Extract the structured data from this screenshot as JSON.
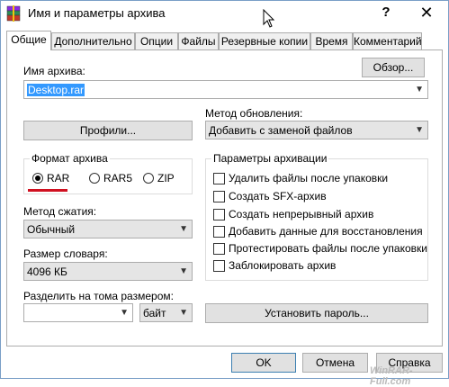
{
  "window": {
    "title": "Имя и параметры архива",
    "help_label": "?",
    "close_label": "✕"
  },
  "tabs": [
    {
      "label": "Общие"
    },
    {
      "label": "Дополнительно"
    },
    {
      "label": "Опции"
    },
    {
      "label": "Файлы"
    },
    {
      "label": "Резервные копии"
    },
    {
      "label": "Время"
    },
    {
      "label": "Комментарий"
    }
  ],
  "archive_name": {
    "label": "Имя архива:",
    "value": "Desktop.rar",
    "browse_label": "Обзор..."
  },
  "profiles_label": "Профили...",
  "update_method": {
    "label": "Метод обновления:",
    "value": "Добавить с заменой файлов"
  },
  "format": {
    "title": "Формат архива",
    "options": [
      {
        "label": "RAR",
        "selected": true
      },
      {
        "label": "RAR5",
        "selected": false
      },
      {
        "label": "ZIP",
        "selected": false
      }
    ]
  },
  "compression": {
    "label": "Метод сжатия:",
    "value": "Обычный"
  },
  "dictionary": {
    "label": "Размер словаря:",
    "value": "4096 КБ"
  },
  "split": {
    "label": "Разделить на тома размером:",
    "value": "",
    "unit": "байт"
  },
  "options": {
    "title": "Параметры архивации",
    "items": [
      {
        "label": "Удалить файлы после упаковки",
        "checked": false
      },
      {
        "label": "Создать SFX-архив",
        "checked": false
      },
      {
        "label": "Создать непрерывный архив",
        "checked": false
      },
      {
        "label": "Добавить данные для восстановления",
        "checked": false
      },
      {
        "label": "Протестировать файлы после упаковки",
        "checked": false
      },
      {
        "label": "Заблокировать архив",
        "checked": false
      }
    ]
  },
  "set_password_label": "Установить пароль...",
  "footer": {
    "ok_label": "OK",
    "cancel_label": "Отмена",
    "help_label": "Справка"
  },
  "watermark": "WinRAR-Full.com",
  "icons": {
    "app": "winrar-books-icon",
    "cursor": "mouse-pointer-icon"
  },
  "colors": {
    "accent": "#3399ff",
    "underline_mark": "#d01020"
  }
}
